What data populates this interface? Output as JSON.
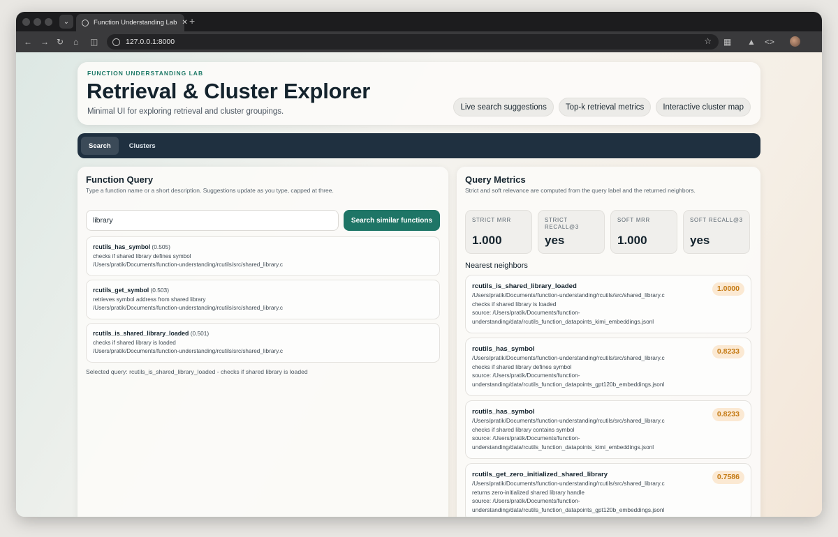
{
  "browser": {
    "tab_title": "Function Understanding Lab",
    "url": "127.0.0.1:8000"
  },
  "hero": {
    "eyebrow": "FUNCTION UNDERSTANDING LAB",
    "title": "Retrieval & Cluster Explorer",
    "subtitle": "Minimal UI for exploring retrieval and cluster groupings.",
    "pills": [
      "Live search suggestions",
      "Top-k retrieval metrics",
      "Interactive cluster map"
    ]
  },
  "nav": {
    "tabs": [
      {
        "label": "Search",
        "active": true
      },
      {
        "label": "Clusters",
        "active": false
      }
    ]
  },
  "query_panel": {
    "title": "Function Query",
    "subtitle": "Type a function name or a short description. Suggestions update as you type, capped at three.",
    "input_value": "library",
    "button_label": "Search similar functions",
    "suggestions": [
      {
        "name": "rcutils_has_symbol",
        "score": "(0.505)",
        "desc": "checks if shared library defines symbol",
        "path": "/Users/pratik/Documents/function-understanding/rcutils/src/shared_library.c"
      },
      {
        "name": "rcutils_get_symbol",
        "score": "(0.503)",
        "desc": "retrieves symbol address from shared library",
        "path": "/Users/pratik/Documents/function-understanding/rcutils/src/shared_library.c"
      },
      {
        "name": "rcutils_is_shared_library_loaded",
        "score": "(0.501)",
        "desc": "checks if shared library is loaded",
        "path": "/Users/pratik/Documents/function-understanding/rcutils/src/shared_library.c"
      }
    ],
    "selected_query": "Selected query: rcutils_is_shared_library_loaded - checks if shared library is loaded"
  },
  "metrics_panel": {
    "title": "Query Metrics",
    "subtitle": "Strict and soft relevance are computed from the query label and the returned neighbors.",
    "metrics": [
      {
        "label": "STRICT MRR",
        "value": "1.000"
      },
      {
        "label": "STRICT RECALL@3",
        "value": "yes"
      },
      {
        "label": "SOFT MRR",
        "value": "1.000"
      },
      {
        "label": "SOFT RECALL@3",
        "value": "yes"
      }
    ],
    "neighbors_title": "Nearest neighbors",
    "neighbors": [
      {
        "name": "rcutils_is_shared_library_loaded",
        "score": "1.0000",
        "path": "/Users/pratik/Documents/function-understanding/rcutils/src/shared_library.c",
        "desc": "checks if shared library is loaded",
        "source1": "source: /Users/pratik/Documents/function-",
        "source2": "understanding/data/rcutils_function_datapoints_kimi_embeddings.jsonl"
      },
      {
        "name": "rcutils_has_symbol",
        "score": "0.8233",
        "path": "/Users/pratik/Documents/function-understanding/rcutils/src/shared_library.c",
        "desc": "checks if shared library defines symbol",
        "source1": "source: /Users/pratik/Documents/function-",
        "source2": "understanding/data/rcutils_function_datapoints_gpt120b_embeddings.jsonl"
      },
      {
        "name": "rcutils_has_symbol",
        "score": "0.8233",
        "path": "/Users/pratik/Documents/function-understanding/rcutils/src/shared_library.c",
        "desc": "checks if shared library contains symbol",
        "source1": "source: /Users/pratik/Documents/function-",
        "source2": "understanding/data/rcutils_function_datapoints_kimi_embeddings.jsonl"
      },
      {
        "name": "rcutils_get_zero_initialized_shared_library",
        "score": "0.7586",
        "path": "/Users/pratik/Documents/function-understanding/rcutils/src/shared_library.c",
        "desc": "returns zero-initialized shared library handle",
        "source1": "source: /Users/pratik/Documents/function-",
        "source2": "understanding/data/rcutils_function_datapoints_gpt120b_embeddings.jsonl"
      }
    ]
  },
  "colors": {
    "accent": "#1e7566",
    "nav_bg": "#1f3040",
    "score_text": "#c47a14",
    "score_bg": "#fbe9d3"
  }
}
